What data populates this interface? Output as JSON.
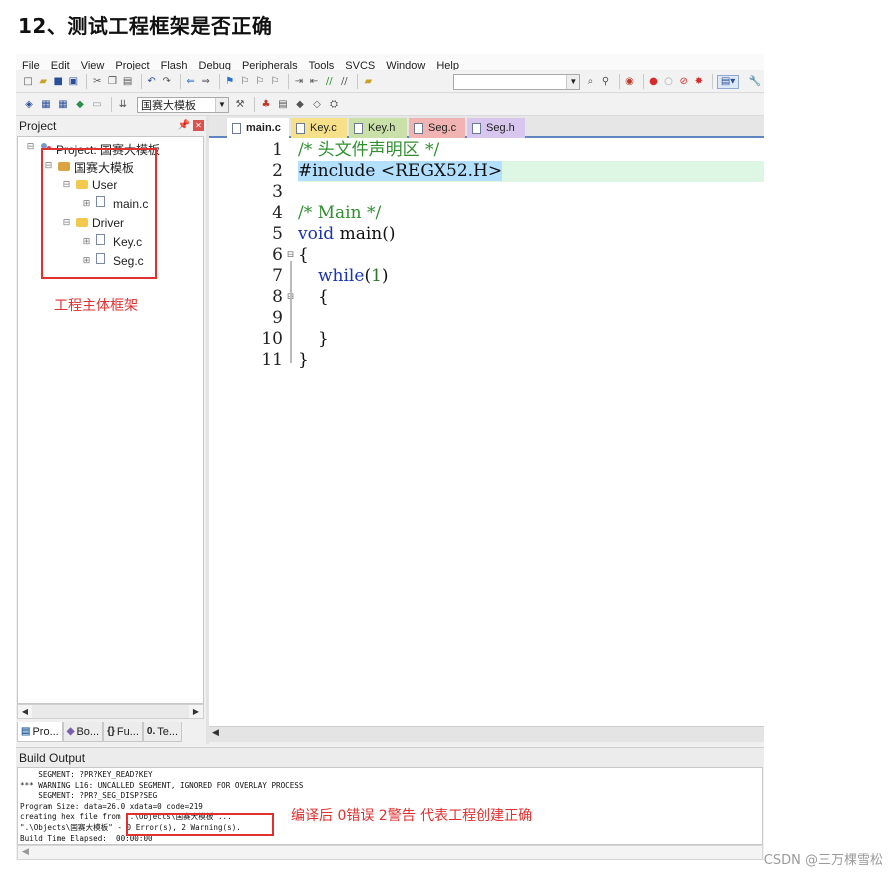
{
  "heading": "12、测试工程框架是否正确",
  "menu": [
    "File",
    "Edit",
    "View",
    "Project",
    "Flash",
    "Debug",
    "Peripherals",
    "Tools",
    "SVCS",
    "Window",
    "Help"
  ],
  "toolbar2": {
    "target": "国赛大模板"
  },
  "project_panel": {
    "title": "Project",
    "pin_icon": "pin-icon",
    "close_icon": "close-icon",
    "root": "Project: 国赛大模板",
    "target": "国赛大模板",
    "groups": [
      {
        "name": "User",
        "files": [
          "main.c"
        ]
      },
      {
        "name": "Driver",
        "files": [
          "Key.c",
          "Seg.c"
        ]
      }
    ],
    "tabs": [
      "Pro...",
      "Bo...",
      "Fu...",
      "Te..."
    ]
  },
  "editor": {
    "tabs": [
      {
        "label": "main.c",
        "color": "#ffffff",
        "active": true
      },
      {
        "label": "Key.c",
        "color": "#f7e08a"
      },
      {
        "label": "Key.h",
        "color": "#c9e0a8"
      },
      {
        "label": "Seg.c",
        "color": "#f2b3b3"
      },
      {
        "label": "Seg.h",
        "color": "#d7c6ee"
      }
    ],
    "line_numbers": [
      "1",
      "2",
      "3",
      "4",
      "5",
      "6",
      "7",
      "8",
      "9",
      "10",
      "11"
    ],
    "lines": {
      "l1": "/* 头文件声明区 */",
      "l2": "#include <REGX52.H>",
      "l4": "/* Main */",
      "l5_kw": "void",
      "l5_rest": " main()",
      "l6": "{",
      "l7_kw": "while",
      "l7_open": "(",
      "l7_num": "1",
      "l7_close": ")",
      "l8": "{",
      "l10": "}",
      "l11": "}"
    }
  },
  "build_output": {
    "title": "Build Output",
    "lines": [
      "    SEGMENT: ?PR?KEY_READ?KEY",
      "*** WARNING L16: UNCALLED SEGMENT, IGNORED FOR OVERLAY PROCESS",
      "    SEGMENT: ?PR?_SEG_DISP?SEG",
      "Program Size: data=26.0 xdata=0 code=219",
      "creating hex file from \".\\Objects\\国赛大模板\"...",
      "\".\\Objects\\国赛大模板\" - 0 Error(s), 2 Warning(s).",
      "Build Time Elapsed:  00:00:00"
    ]
  },
  "annotations": {
    "tree_note": "工程主体框架",
    "build_note": "编译后 0错误 2警告 代表工程创建正确",
    "color": "#e03030"
  },
  "watermark": "CSDN @三万棵雪松"
}
